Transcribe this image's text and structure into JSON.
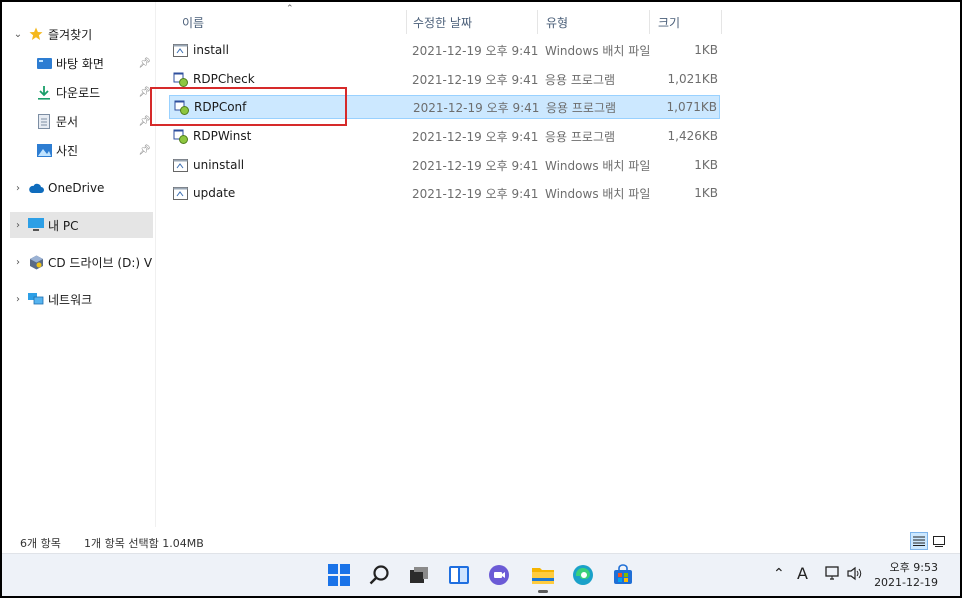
{
  "sidebar": {
    "items": [
      {
        "label": "즐겨찾기",
        "icon": "star-icon"
      },
      {
        "label": "바탕 화면",
        "icon": "desktop-icon"
      },
      {
        "label": "다운로드",
        "icon": "download-icon"
      },
      {
        "label": "문서",
        "icon": "document-icon"
      },
      {
        "label": "사진",
        "icon": "picture-icon"
      },
      {
        "label": "OneDrive",
        "icon": "cloud-icon"
      },
      {
        "label": "내 PC",
        "icon": "pc-icon"
      },
      {
        "label": "CD 드라이브 (D:) V",
        "icon": "cd-drive-icon"
      },
      {
        "label": "네트워크",
        "icon": "network-icon"
      }
    ]
  },
  "columns": {
    "name": "이름",
    "date": "수정한 날짜",
    "type": "유형",
    "size": "크기"
  },
  "files": [
    {
      "name": "install",
      "date": "2021-12-19 오후 9:41",
      "type": "Windows 배치 파일",
      "size": "1KB",
      "icon": "batch-file-icon"
    },
    {
      "name": "RDPCheck",
      "date": "2021-12-19 오후 9:41",
      "type": "응용 프로그램",
      "size": "1,021KB",
      "icon": "application-icon"
    },
    {
      "name": "RDPConf",
      "date": "2021-12-19 오후 9:41",
      "type": "응용 프로그램",
      "size": "1,071KB",
      "icon": "application-icon"
    },
    {
      "name": "RDPWinst",
      "date": "2021-12-19 오후 9:41",
      "type": "응용 프로그램",
      "size": "1,426KB",
      "icon": "application-icon"
    },
    {
      "name": "uninstall",
      "date": "2021-12-19 오후 9:41",
      "type": "Windows 배치 파일",
      "size": "1KB",
      "icon": "batch-file-icon"
    },
    {
      "name": "update",
      "date": "2021-12-19 오후 9:41",
      "type": "Windows 배치 파일",
      "size": "1KB",
      "icon": "batch-file-icon"
    }
  ],
  "selected_file": "RDPConf",
  "status": {
    "count": "6개 항목",
    "selection": "1개 항목 선택함 1.04MB"
  },
  "tray": {
    "ime": "A",
    "time": "오후 9:53",
    "date": "2021-12-19"
  },
  "colors": {
    "selection": "#cce8ff",
    "highlight_border": "#d62a2a",
    "header_text": "#4c607a"
  }
}
